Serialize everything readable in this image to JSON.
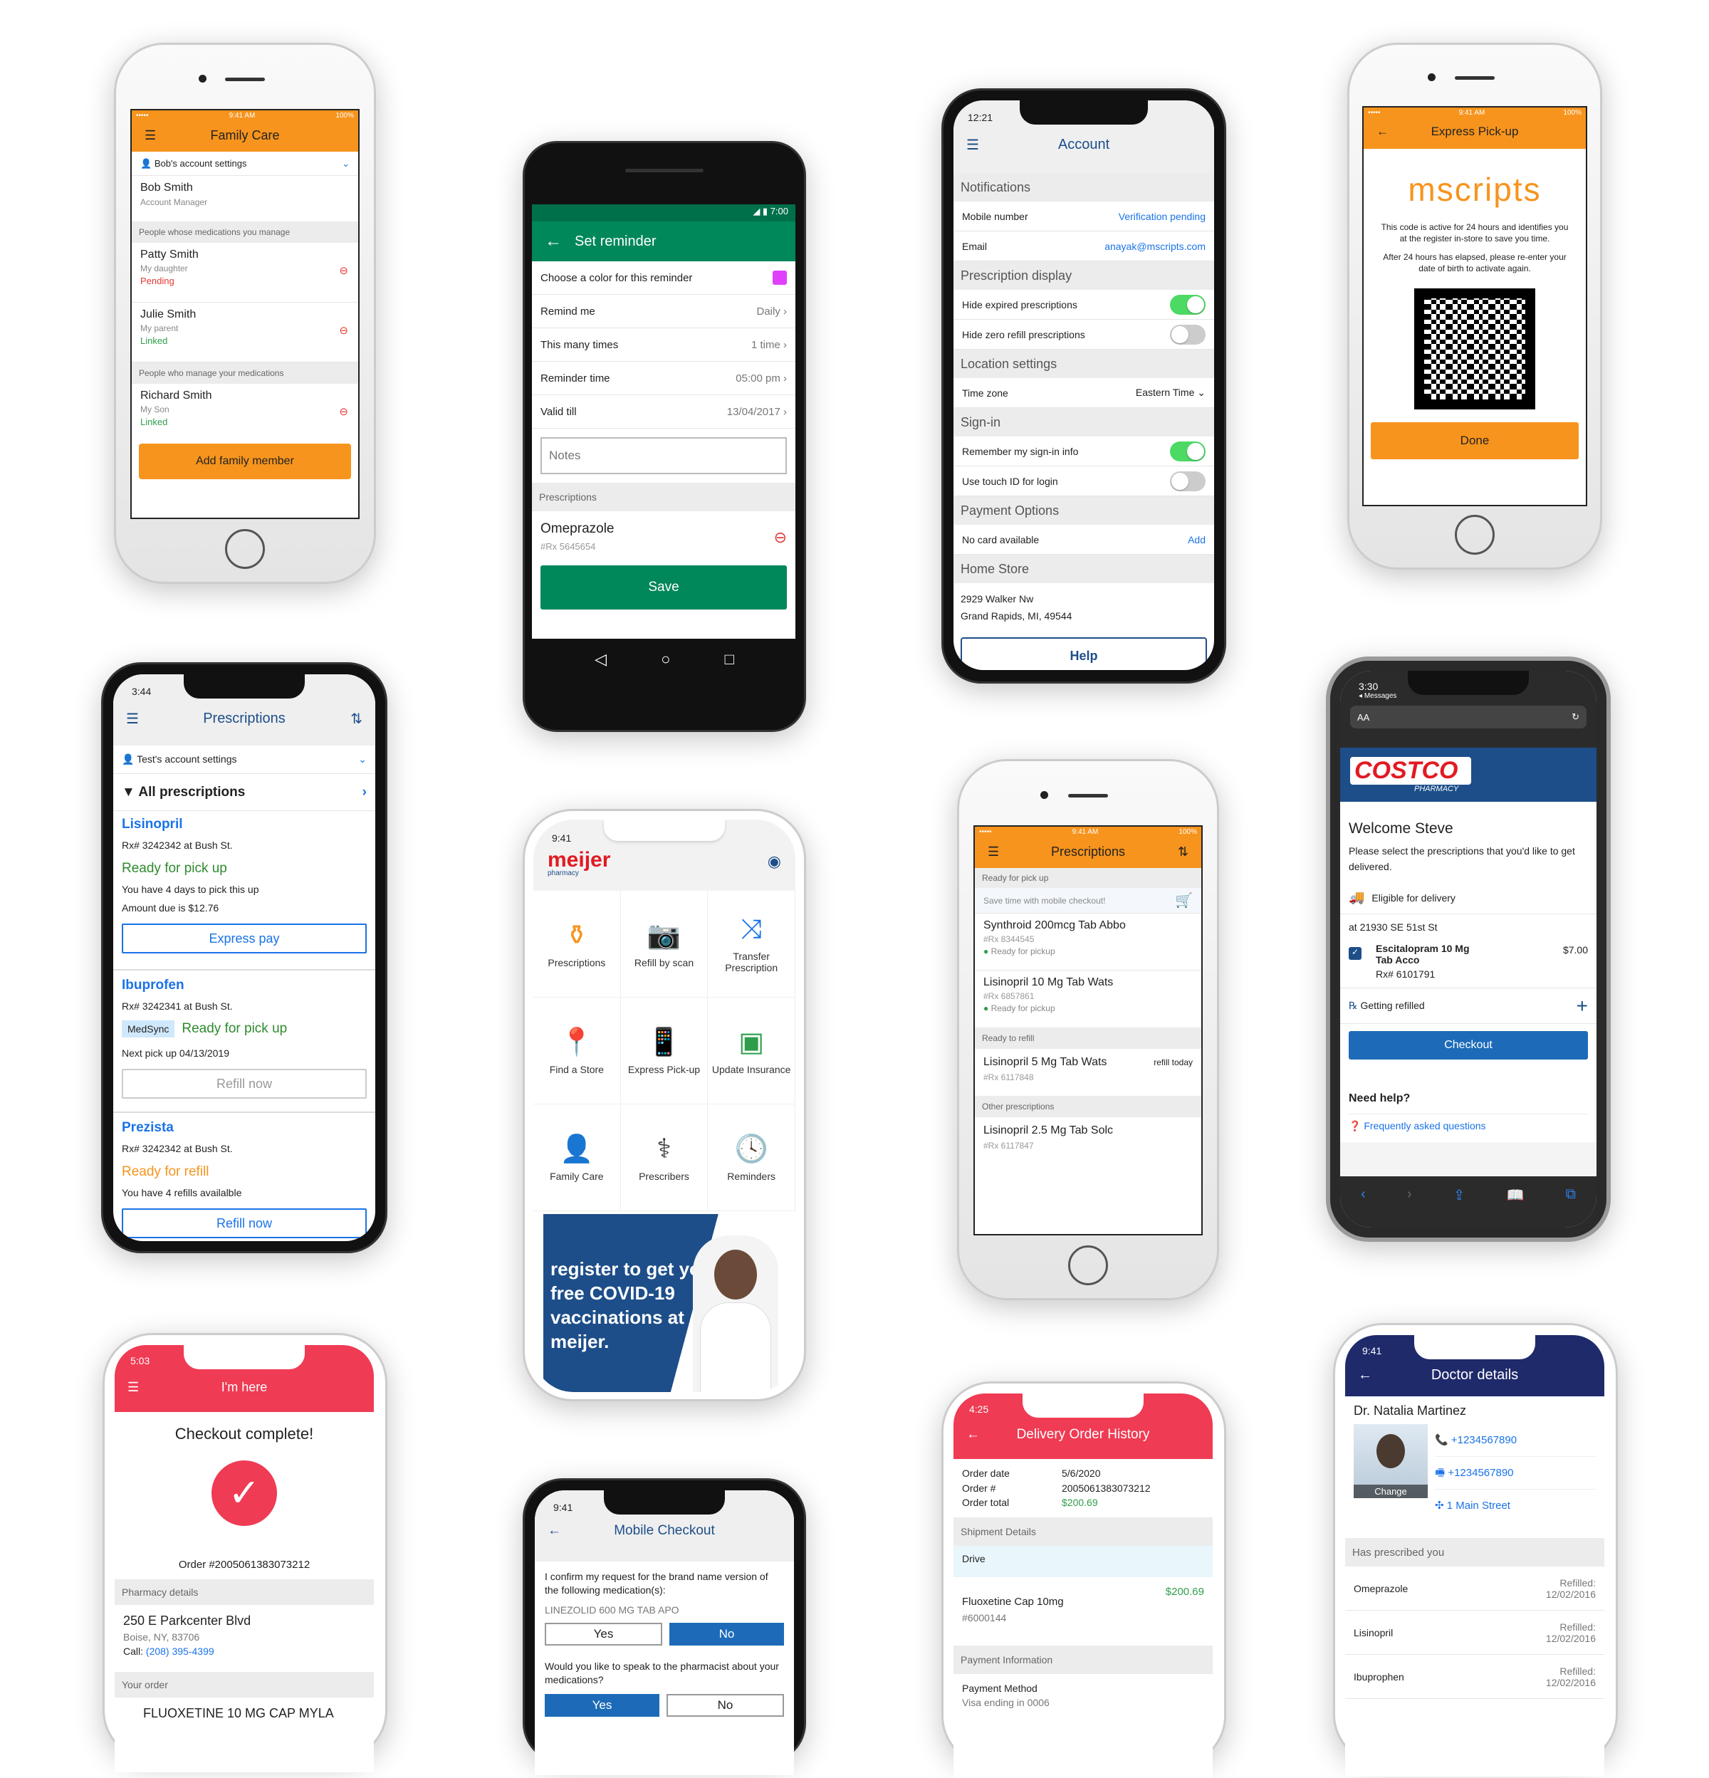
{
  "p1": {
    "status_time": "9:41 AM",
    "status_batt": "100%",
    "title": "Family Care",
    "account": "Bob's account settings",
    "user_name": "Bob Smith",
    "user_role": "Account Manager",
    "sec1": "People whose medications you manage",
    "m1_name": "Patty Smith",
    "m1_rel": "My daughter",
    "m1_status": "Pending",
    "m2_name": "Julie Smith",
    "m2_rel": "My parent",
    "m2_status": "Linked",
    "sec2": "People who manage your medications",
    "m3_name": "Richard Smith",
    "m3_rel": "My Son",
    "m3_status": "Linked",
    "add_btn": "Add family member"
  },
  "p2": {
    "time": "7:00",
    "title": "Set reminder",
    "r1": "Choose a color for this reminder",
    "r2": "Remind me",
    "r2v": "Daily",
    "r3": "This many times",
    "r3v": "1 time",
    "r4": "Reminder time",
    "r4v": "05:00 pm",
    "r5": "Valid till",
    "r5v": "13/04/2017",
    "notes_ph": "Notes",
    "sec": "Prescriptions",
    "drug": "Omeprazole",
    "rx": "#Rx 5645654",
    "save": "Save",
    "color": "#e040fb"
  },
  "p3": {
    "time": "12:21",
    "title": "Account",
    "s1": "Notifications",
    "r1": "Mobile number",
    "r1v": "Verification pending",
    "r2": "Email",
    "r2v": "anayak@mscripts.com",
    "s2": "Prescription display",
    "r3": "Hide expired prescriptions",
    "r4": "Hide zero refill prescriptions",
    "s3": "Location settings",
    "r5": "Time zone",
    "r5v": "Eastern Time",
    "s4": "Sign-in",
    "r6": "Remember my sign-in info",
    "r7": "Use touch ID for login",
    "s5": "Payment Options",
    "r8": "No card available",
    "r8v": "Add",
    "s6": "Home Store",
    "addr1": "2929 Walker Nw",
    "addr2": "Grand Rapids, MI, 49544",
    "help": "Help"
  },
  "p4": {
    "status_time": "9:41 AM",
    "status_batt": "100%",
    "title": "Express Pick-up",
    "brand": "mscripts",
    "t1": "This code is active for 24 hours and identifies you at the register in-store to save you time.",
    "t2": "After 24 hours has elapsed, please re-enter your date of birth to activate again.",
    "done": "Done"
  },
  "p5": {
    "time": "3:44",
    "title": "Prescriptions",
    "account": "Test's account settings",
    "filter": "All prescriptions",
    "d1": "Lisinopril",
    "d1rx": "Rx# 3242342 at Bush St.",
    "d1s": "Ready for pick up",
    "d1a": "You have 4 days to pick this up",
    "d1b": "Amount due is $12.76",
    "d1btn": "Express pay",
    "d2": "Ibuprofen",
    "d2rx": "Rx# 3242341 at Bush St.",
    "d2tag": "MedSync",
    "d2s": "Ready for pick up",
    "d2a": "Next pick up 04/13/2019",
    "d2btn": "Refill now",
    "d3": "Prezista",
    "d3rx": "Rx# 3242342 at Bush St.",
    "d3s": "Ready for refill",
    "d3a": "You have 4 refills availalble",
    "d3btn": "Refill now"
  },
  "p6": {
    "time": "9:41",
    "brand": "meijer",
    "brand_sub": "pharmacy",
    "tiles": [
      "Prescriptions",
      "Refill by scan",
      "Transfer Prescription",
      "Find a Store",
      "Express Pick-up",
      "Update Insurance",
      "Family Care",
      "Prescribers",
      "Reminders"
    ],
    "banner": "register to get your free COVID-19 vaccinations at meijer."
  },
  "p7": {
    "status_time": "9:41 AM",
    "status_batt": "100%",
    "title": "Prescriptions",
    "s1": "Ready for pick up",
    "promo": "Save time with mobile checkout!",
    "i1": "Synthroid 200mcg Tab Abbo",
    "i1rx": "#Rx 8344545",
    "i1s": "Ready for pickup",
    "i2": "Lisinopril 10 Mg Tab Wats",
    "i2rx": "#Rx 6857861",
    "i2s": "Ready for pickup",
    "s2": "Ready to refill",
    "i3": "Lisinopril 5 Mg Tab Wats",
    "i3v": "refill today",
    "i3rx": "#Rx 6117848",
    "s3": "Other prescriptions",
    "i4": "Lisinopril 2.5 Mg Tab Solc",
    "i4rx": "#Rx 6117847"
  },
  "p8": {
    "time": "3:30",
    "back": "Messages",
    "aa": "AA",
    "brand": "COSTCO",
    "brand_sub": "PHARMACY",
    "welcome": "Welcome Steve",
    "intro": "Please select the prescriptions that you'd like to get delivered.",
    "eligible": "Eligible for delivery",
    "addr": "at 21930 SE 51st St",
    "drug": "Escitalopram 10 Mg Tab Acco",
    "rx": "Rx# 6101791",
    "price": "$7.00",
    "refill": "Getting refilled",
    "checkout": "Checkout",
    "help": "Need help?",
    "faq": "Frequently asked questions"
  },
  "p9": {
    "time": "5:03",
    "title": "I'm here",
    "heading": "Checkout complete!",
    "order": "Order #2005061383073212",
    "s1": "Pharmacy details",
    "addr1": "250 E Parkcenter Blvd",
    "addr2": "Boise, NY, 83706",
    "call": "Call:",
    "phone": "(208) 395-4399",
    "s2": "Your order",
    "drug": "FLUOXETINE 10 MG CAP MYLA"
  },
  "p10": {
    "time": "9:41",
    "title": "Mobile Checkout",
    "q1": "I confirm my request for the brand name version of the following medication(s):",
    "med": "LINEZOLID 600 MG TAB APO",
    "yes": "Yes",
    "no": "No",
    "q2": "Would you like to speak to the pharmacist about your medications?"
  },
  "p11": {
    "time": "4:25",
    "title": "Delivery Order History",
    "l1": "Order date",
    "v1": "5/6/2020",
    "l2": "Order #",
    "v2": "2005061383073212",
    "l3": "Order total",
    "v3": "$200.69",
    "s1": "Shipment Details",
    "drive": "Drive",
    "drug": "Fluoxetine Cap 10mg",
    "drug_rx": "#6000144",
    "drug_price": "$200.69",
    "s2": "Payment Information",
    "pm": "Payment Method",
    "pm_sub": "Visa ending in 0006"
  },
  "p12": {
    "time": "9:41",
    "title": "Doctor details",
    "name": "Dr. Natalia Martinez",
    "change": "Change",
    "ph1": "+1234567890",
    "ph2": "+1234567890",
    "addr": "1 Main Street",
    "sec": "Has prescribed you",
    "refilled": "Refilled:",
    "meds": [
      {
        "n": "Omeprazole",
        "d": "12/02/2016"
      },
      {
        "n": "Lisinopril",
        "d": "12/02/2016"
      },
      {
        "n": "Ibuprophen",
        "d": "12/02/2016"
      }
    ]
  }
}
